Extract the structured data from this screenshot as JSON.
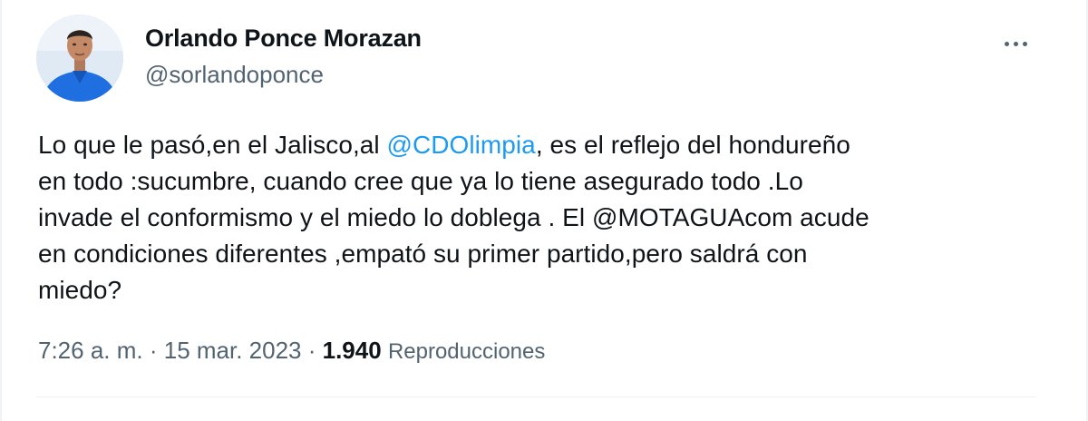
{
  "author": {
    "display_name": "Orlando Ponce Morazan",
    "handle": "@sorlandoponce"
  },
  "more_icon": "more-horizontal-icon",
  "tweet": {
    "lines": [
      {
        "before": "Lo que le pasó,en el Jalisco,al ",
        "mention": "@CDOlimpia",
        "after": ", es el reflejo del hondureño"
      },
      {
        "text": "en todo :sucumbre, cuando cree que ya lo tiene asegurado todo .Lo"
      },
      {
        "text": "invade el conformismo y el miedo lo doblega . El @MOTAGUAcom acude"
      },
      {
        "text": "en condiciones diferentes ,empató su primer partido,pero saldrá con"
      },
      {
        "text": "miedo?"
      }
    ]
  },
  "meta": {
    "time": "7:26 a. m.",
    "separator": " · ",
    "date": "15 mar. 2023",
    "views_count": "1.940",
    "views_label": "Reproducciones"
  },
  "colors": {
    "link": "#1d9bf0",
    "secondary_text": "#536471",
    "primary_text": "#0f1419"
  }
}
